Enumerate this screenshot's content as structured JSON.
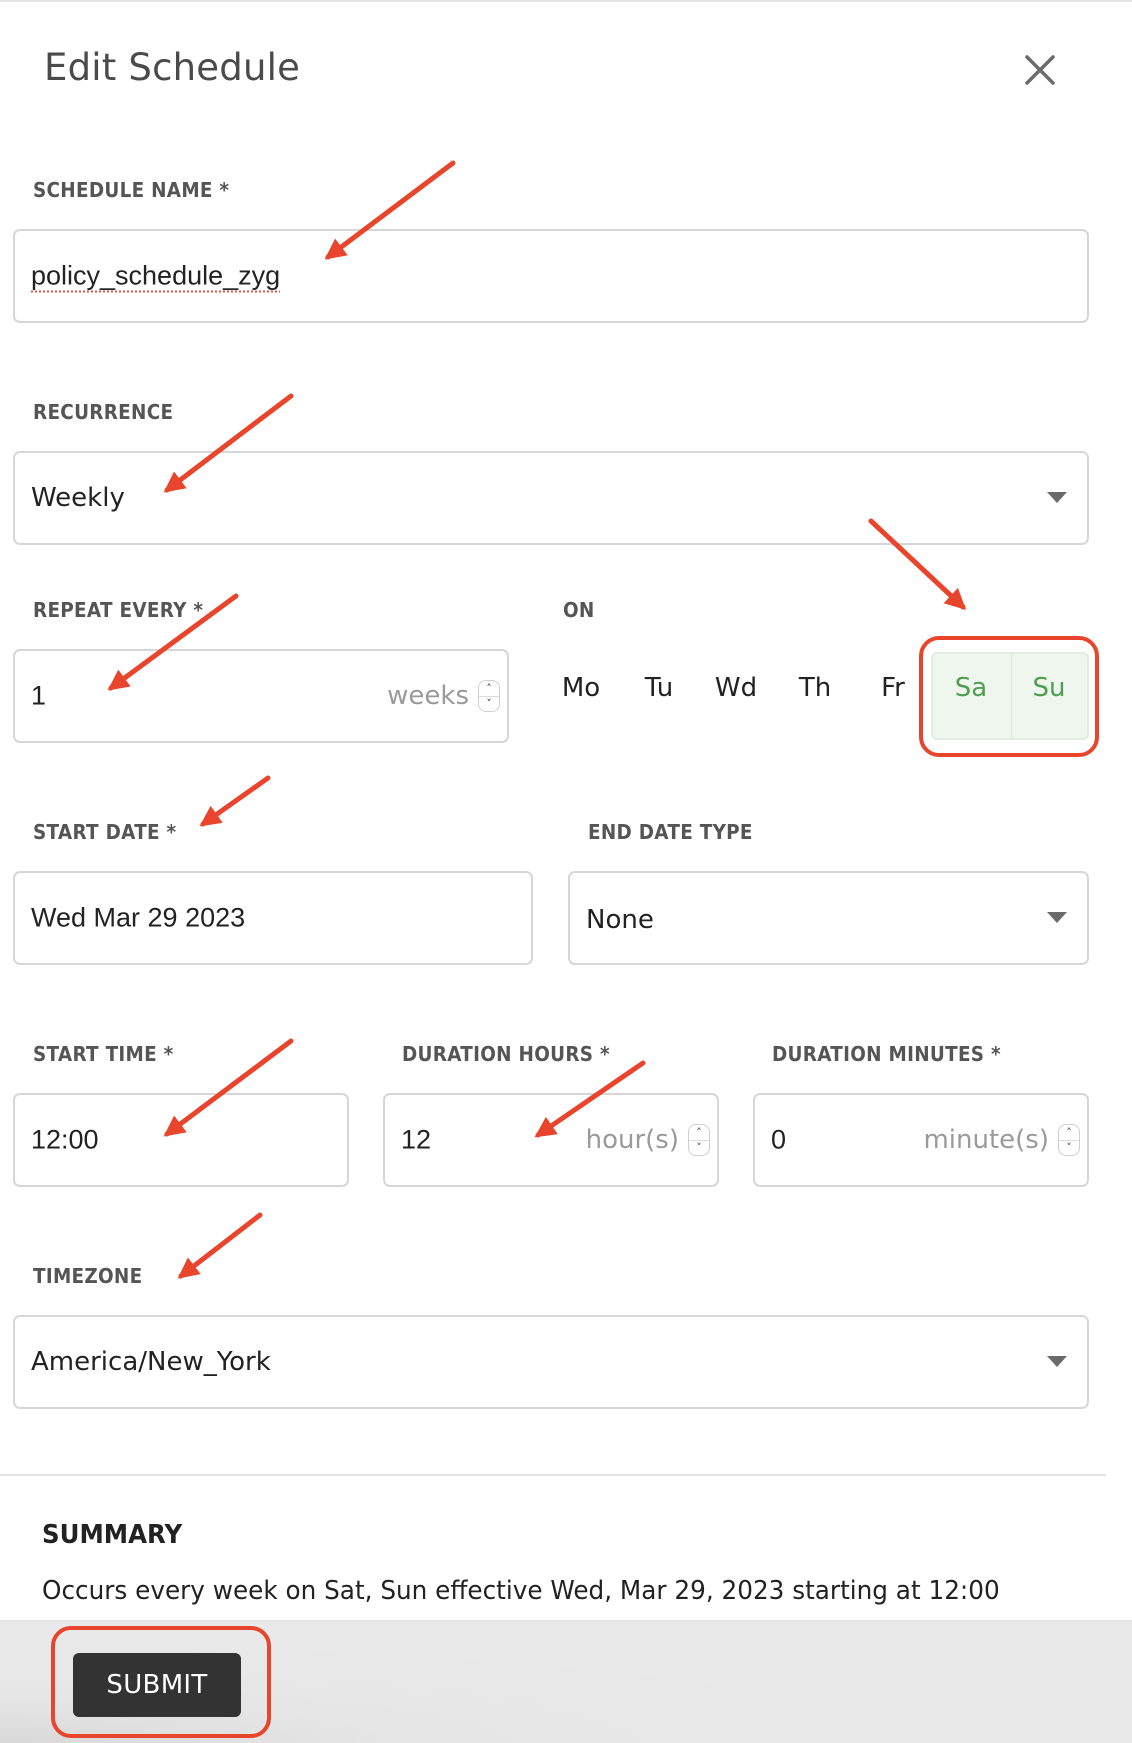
{
  "dialog": {
    "title": "Edit Schedule",
    "close_icon": "close-icon"
  },
  "fields": {
    "schedule_name": {
      "label": "SCHEDULE NAME *",
      "value": "policy_schedule_zyg"
    },
    "recurrence": {
      "label": "RECURRENCE",
      "value": "Weekly"
    },
    "repeat_every": {
      "label": "REPEAT EVERY *",
      "value": "1",
      "unit": "weeks"
    },
    "on": {
      "label": "ON",
      "days": [
        {
          "label": "Mo",
          "selected": false
        },
        {
          "label": "Tu",
          "selected": false
        },
        {
          "label": "Wd",
          "selected": false
        },
        {
          "label": "Th",
          "selected": false
        },
        {
          "label": "Fr",
          "selected": false
        },
        {
          "label": "Sa",
          "selected": true
        },
        {
          "label": "Su",
          "selected": true
        }
      ]
    },
    "start_date": {
      "label": "START DATE *",
      "value": "Wed Mar 29 2023"
    },
    "end_date_type": {
      "label": "END DATE TYPE",
      "value": "None"
    },
    "start_time": {
      "label": "START TIME *",
      "value": "12:00"
    },
    "duration_hours": {
      "label": "DURATION HOURS *",
      "value": "12",
      "unit": "hour(s)"
    },
    "duration_minutes": {
      "label": "DURATION MINUTES *",
      "value": "0",
      "unit": "minute(s)"
    },
    "timezone": {
      "label": "TIMEZONE",
      "value": "America/New_York"
    }
  },
  "summary": {
    "heading": "SUMMARY",
    "text": "Occurs every week on Sat, Sun effective Wed, Mar 29, 2023 starting at 12:00"
  },
  "footer": {
    "submit_label": "SUBMIT"
  },
  "colors": {
    "selected_day_text": "#4f9e4f",
    "selected_day_bg": "#eef6ee",
    "submit_bg": "#333333",
    "annotation_red": "#e8452c"
  },
  "spinner": {
    "up": "˄",
    "down": "˅"
  }
}
